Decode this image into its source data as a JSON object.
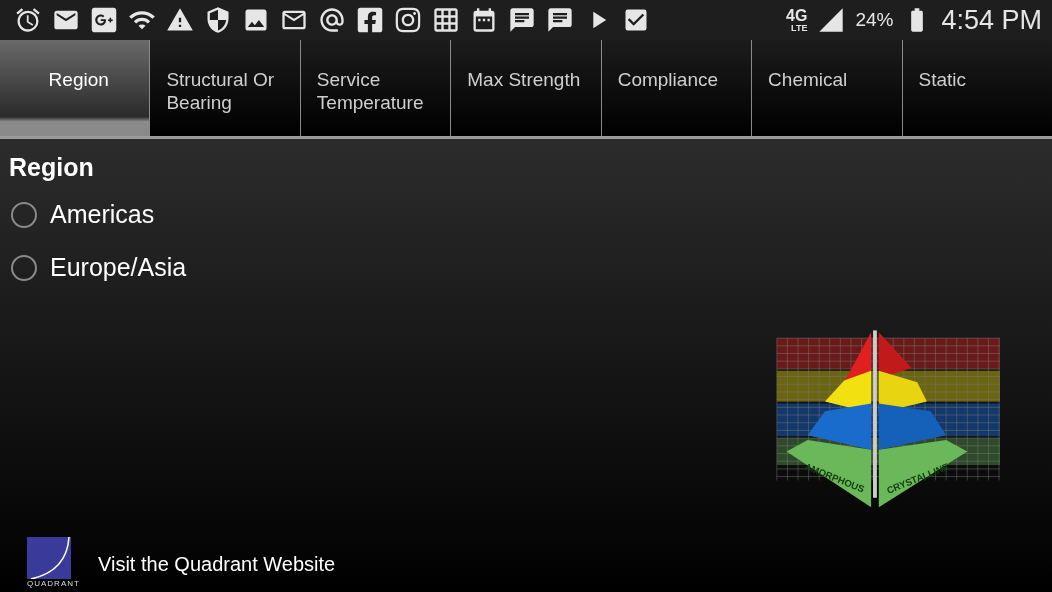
{
  "status_bar": {
    "network": "4G",
    "network_sub": "LTE",
    "battery": "24%",
    "time": "4:54 PM"
  },
  "tabs": [
    {
      "label": "Region",
      "selected": true
    },
    {
      "label": "Structural Or Bearing",
      "selected": false
    },
    {
      "label": "Service Temperature",
      "selected": false
    },
    {
      "label": "Max Strength",
      "selected": false
    },
    {
      "label": "Compliance",
      "selected": false
    },
    {
      "label": "Chemical",
      "selected": false
    },
    {
      "label": "Static",
      "selected": false
    }
  ],
  "section": {
    "title": "Region",
    "options": [
      {
        "label": "Americas",
        "selected": false
      },
      {
        "label": "Europe/Asia",
        "selected": false
      }
    ]
  },
  "pyramid": {
    "left_label": "AMORPHOUS",
    "right_label": "CRYSTALLINE"
  },
  "footer": {
    "logo_text": "QUADRANT",
    "link": "Visit the Quadrant Website"
  }
}
